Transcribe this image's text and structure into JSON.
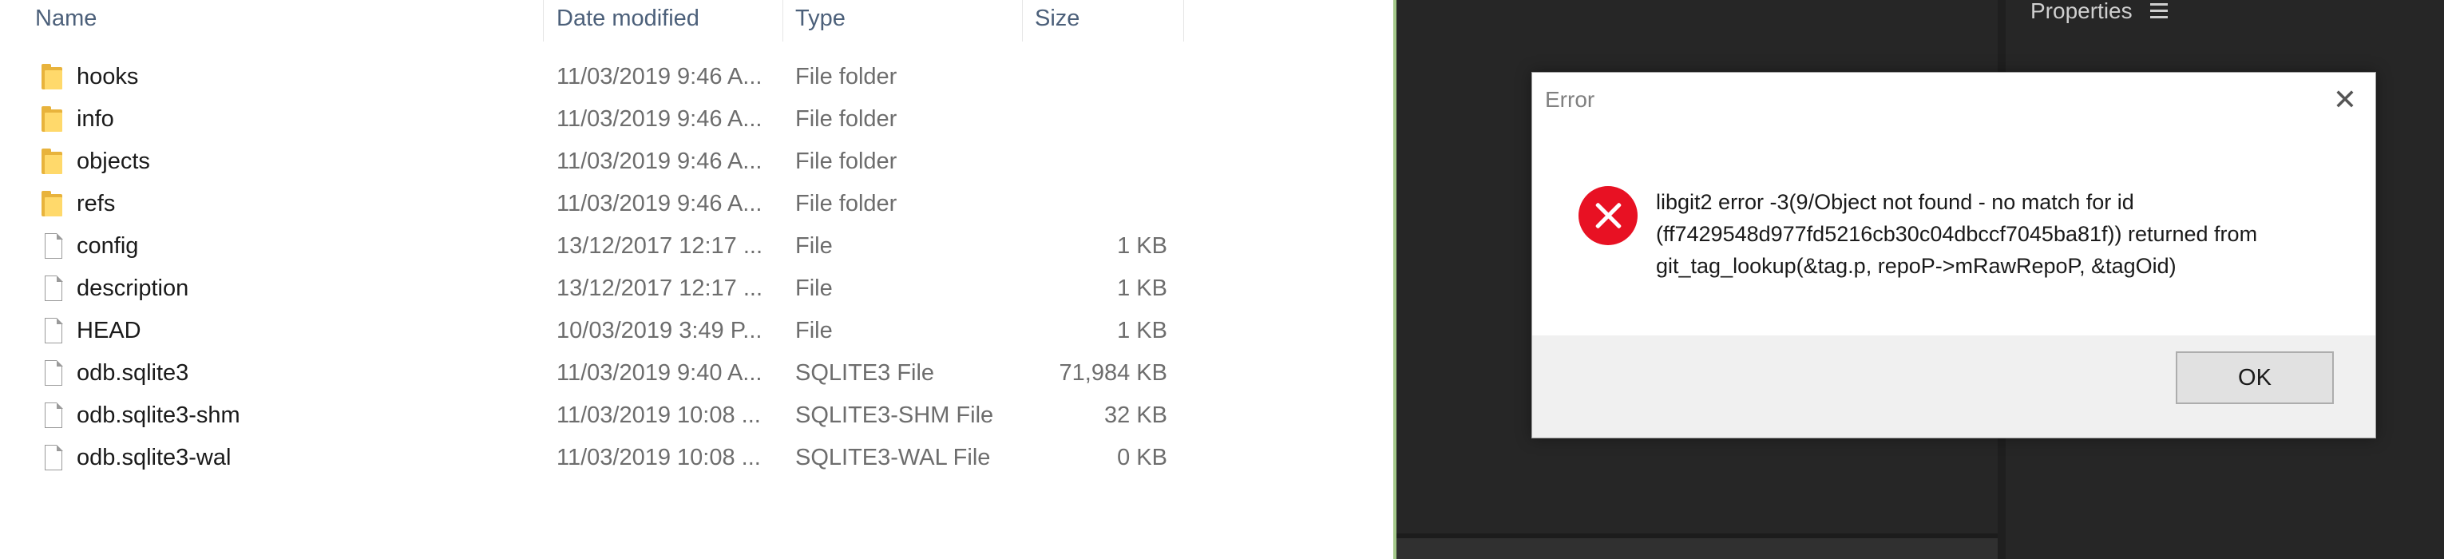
{
  "explorer": {
    "columns": {
      "name": "Name",
      "date": "Date modified",
      "type": "Type",
      "size": "Size"
    },
    "rows": [
      {
        "name": "hooks",
        "date": "11/03/2019 9:46 A...",
        "type": "File folder",
        "size": "",
        "icon": "folder-icon"
      },
      {
        "name": "info",
        "date": "11/03/2019 9:46 A...",
        "type": "File folder",
        "size": "",
        "icon": "folder-icon"
      },
      {
        "name": "objects",
        "date": "11/03/2019 9:46 A...",
        "type": "File folder",
        "size": "",
        "icon": "folder-icon"
      },
      {
        "name": "refs",
        "date": "11/03/2019 9:46 A...",
        "type": "File folder",
        "size": "",
        "icon": "folder-icon"
      },
      {
        "name": "config",
        "date": "13/12/2017 12:17 ...",
        "type": "File",
        "size": "1 KB",
        "icon": "file-icon"
      },
      {
        "name": "description",
        "date": "13/12/2017 12:17 ...",
        "type": "File",
        "size": "1 KB",
        "icon": "file-icon"
      },
      {
        "name": "HEAD",
        "date": "10/03/2019 3:49 P...",
        "type": "File",
        "size": "1 KB",
        "icon": "file-icon"
      },
      {
        "name": "odb.sqlite3",
        "date": "11/03/2019 9:40 A...",
        "type": "SQLITE3 File",
        "size": "71,984 KB",
        "icon": "file-icon"
      },
      {
        "name": "odb.sqlite3-shm",
        "date": "11/03/2019 10:08 ...",
        "type": "SQLITE3-SHM File",
        "size": "32 KB",
        "icon": "file-icon"
      },
      {
        "name": "odb.sqlite3-wal",
        "date": "11/03/2019 10:08 ...",
        "type": "SQLITE3-WAL File",
        "size": "0 KB",
        "icon": "file-icon"
      }
    ]
  },
  "properties_panel": {
    "label": "Properties",
    "menu_icon": "hamburger-icon"
  },
  "dialog": {
    "title": "Error",
    "close_icon": "close-icon",
    "status_icon": "error-icon",
    "message": "libgit2 error -3(9/Object not found - no match for id (ff7429548d977fd5216cb30c04dbccf7045ba81f)) returned from git_tag_lookup(&tag.p, repoP->mRawRepoP, &tagOid)",
    "ok_label": "OK"
  },
  "colors": {
    "error_red": "#e81123",
    "dark_bg": "#262626",
    "folder_yellow": "#ffd96b"
  }
}
